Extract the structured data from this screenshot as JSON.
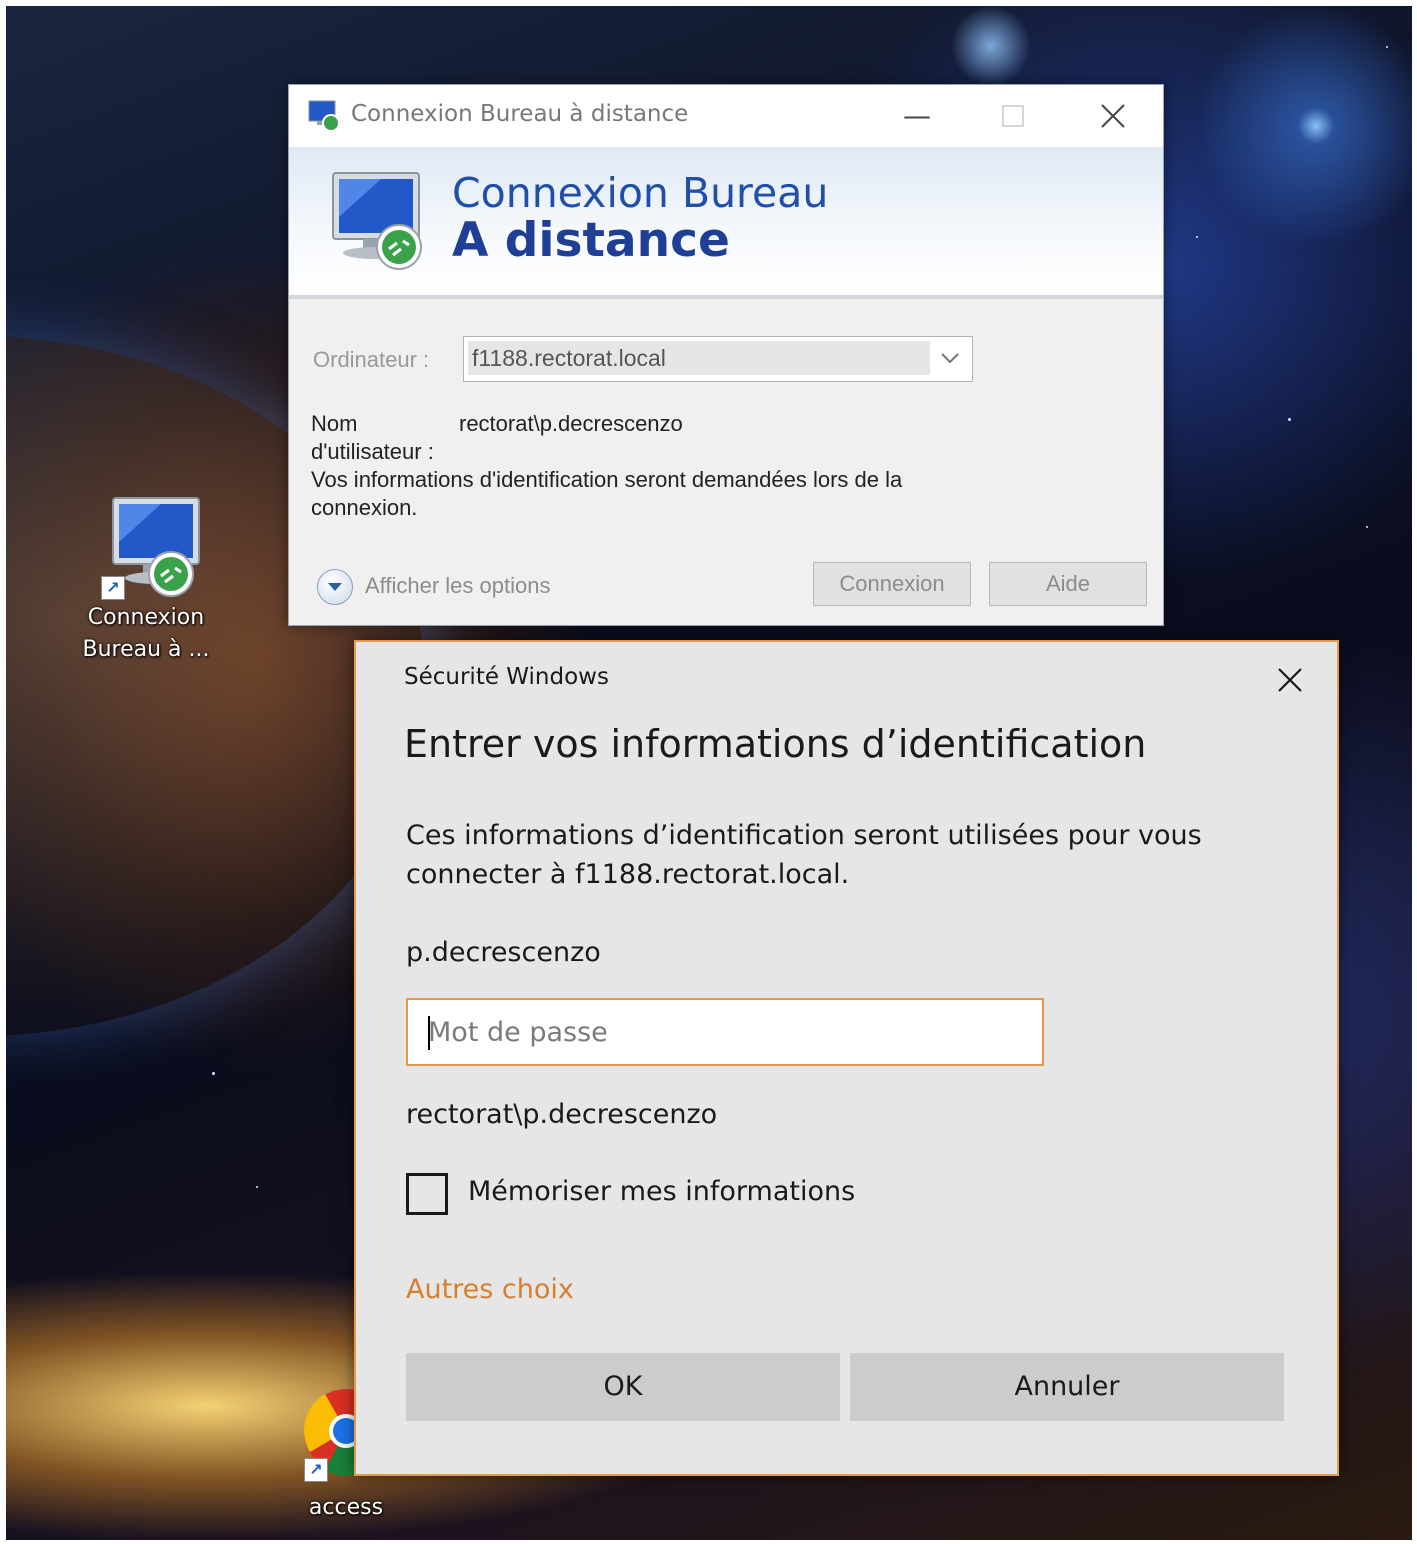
{
  "desktop": {
    "icons": [
      {
        "label_line1": "Connexion",
        "label_line2": "Bureau à ..."
      },
      {
        "label": "access"
      }
    ]
  },
  "rdp_window": {
    "title": "Connexion Bureau à distance",
    "banner_line1": "Connexion Bureau",
    "banner_line2": "A distance",
    "computer_label": "Ordinateur :",
    "computer_value": "f1188.rectorat.local",
    "username_label_line1": "Nom",
    "username_label_line2": "d'utilisateur :",
    "username_value": "rectorat\\p.decrescenzo",
    "credentials_note_line1": "Vos informations d'identification seront demandées lors de la",
    "credentials_note_line2": "connexion.",
    "show_options": "Afficher les options",
    "connect_button": "Connexion",
    "help_button": "Aide"
  },
  "security_dialog": {
    "window_title": "Sécurité Windows",
    "heading": "Entrer vos informations d’identification",
    "description_line1": "Ces informations d’identification seront utilisées pour vous",
    "description_line2": "connecter à f1188.rectorat.local.",
    "username": "p.decrescenzo",
    "password_placeholder": "Mot de passe",
    "domain_user": "rectorat\\p.decrescenzo",
    "remember_label": "Mémoriser mes informations",
    "remember_checked": false,
    "more_choices": "Autres choix",
    "ok_button": "OK",
    "cancel_button": "Annuler"
  },
  "colors": {
    "accent_orange": "#e39a4d",
    "rdp_banner_blue": "#1f4fa8",
    "dialog_background": "#e6e6e6"
  }
}
